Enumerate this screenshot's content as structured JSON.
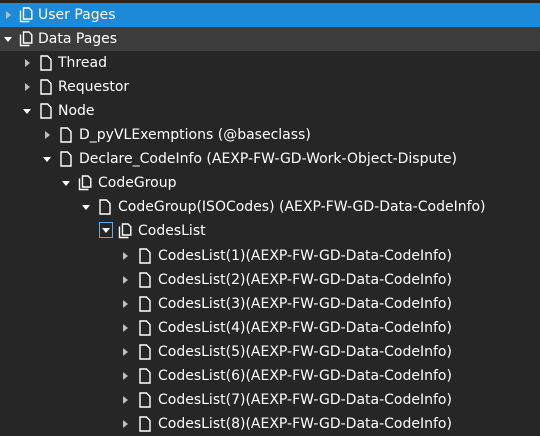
{
  "tree": {
    "rows": [
      {
        "label": "User Pages",
        "toggle": "collapsed",
        "icon": "pages-stack-icon"
      },
      {
        "label": "Data Pages",
        "toggle": "expanded",
        "icon": "pages-stack-icon"
      },
      {
        "label": "Thread",
        "toggle": "collapsed",
        "icon": "page-icon"
      },
      {
        "label": "Requestor",
        "toggle": "collapsed",
        "icon": "page-icon"
      },
      {
        "label": "Node",
        "toggle": "expanded",
        "icon": "page-icon"
      },
      {
        "label": "D_pyVLExemptions (@baseclass)",
        "toggle": "collapsed",
        "icon": "page-icon"
      },
      {
        "label": "Declare_CodeInfo (AEXP-FW-GD-Work-Object-Dispute)",
        "toggle": "expanded",
        "icon": "page-icon"
      },
      {
        "label": "CodeGroup",
        "toggle": "expanded",
        "icon": "pages-stack-icon"
      },
      {
        "label": "CodeGroup(ISOCodes) (AEXP-FW-GD-Data-CodeInfo)",
        "toggle": "expanded",
        "icon": "page-icon"
      },
      {
        "label": "CodesList",
        "toggle": "expanded",
        "icon": "pages-stack-icon"
      },
      {
        "label": "CodesList(1)(AEXP-FW-GD-Data-CodeInfo)",
        "toggle": "collapsed",
        "icon": "page-icon"
      },
      {
        "label": "CodesList(2)(AEXP-FW-GD-Data-CodeInfo)",
        "toggle": "collapsed",
        "icon": "page-icon"
      },
      {
        "label": "CodesList(3)(AEXP-FW-GD-Data-CodeInfo)",
        "toggle": "collapsed",
        "icon": "page-icon"
      },
      {
        "label": "CodesList(4)(AEXP-FW-GD-Data-CodeInfo)",
        "toggle": "collapsed",
        "icon": "page-icon"
      },
      {
        "label": "CodesList(5)(AEXP-FW-GD-Data-CodeInfo)",
        "toggle": "collapsed",
        "icon": "page-icon"
      },
      {
        "label": "CodesList(6)(AEXP-FW-GD-Data-CodeInfo)",
        "toggle": "collapsed",
        "icon": "page-icon"
      },
      {
        "label": "CodesList(7)(AEXP-FW-GD-Data-CodeInfo)",
        "toggle": "collapsed",
        "icon": "page-icon"
      },
      {
        "label": "CodesList(8)(AEXP-FW-GD-Data-CodeInfo)",
        "toggle": "collapsed",
        "icon": "page-icon"
      }
    ]
  },
  "colors": {
    "background": "#262626",
    "selected_row": "#1c8ad8",
    "section_row": "#3c3c3c",
    "text": "#ffffff",
    "focus_border": "#6aa8d8"
  }
}
